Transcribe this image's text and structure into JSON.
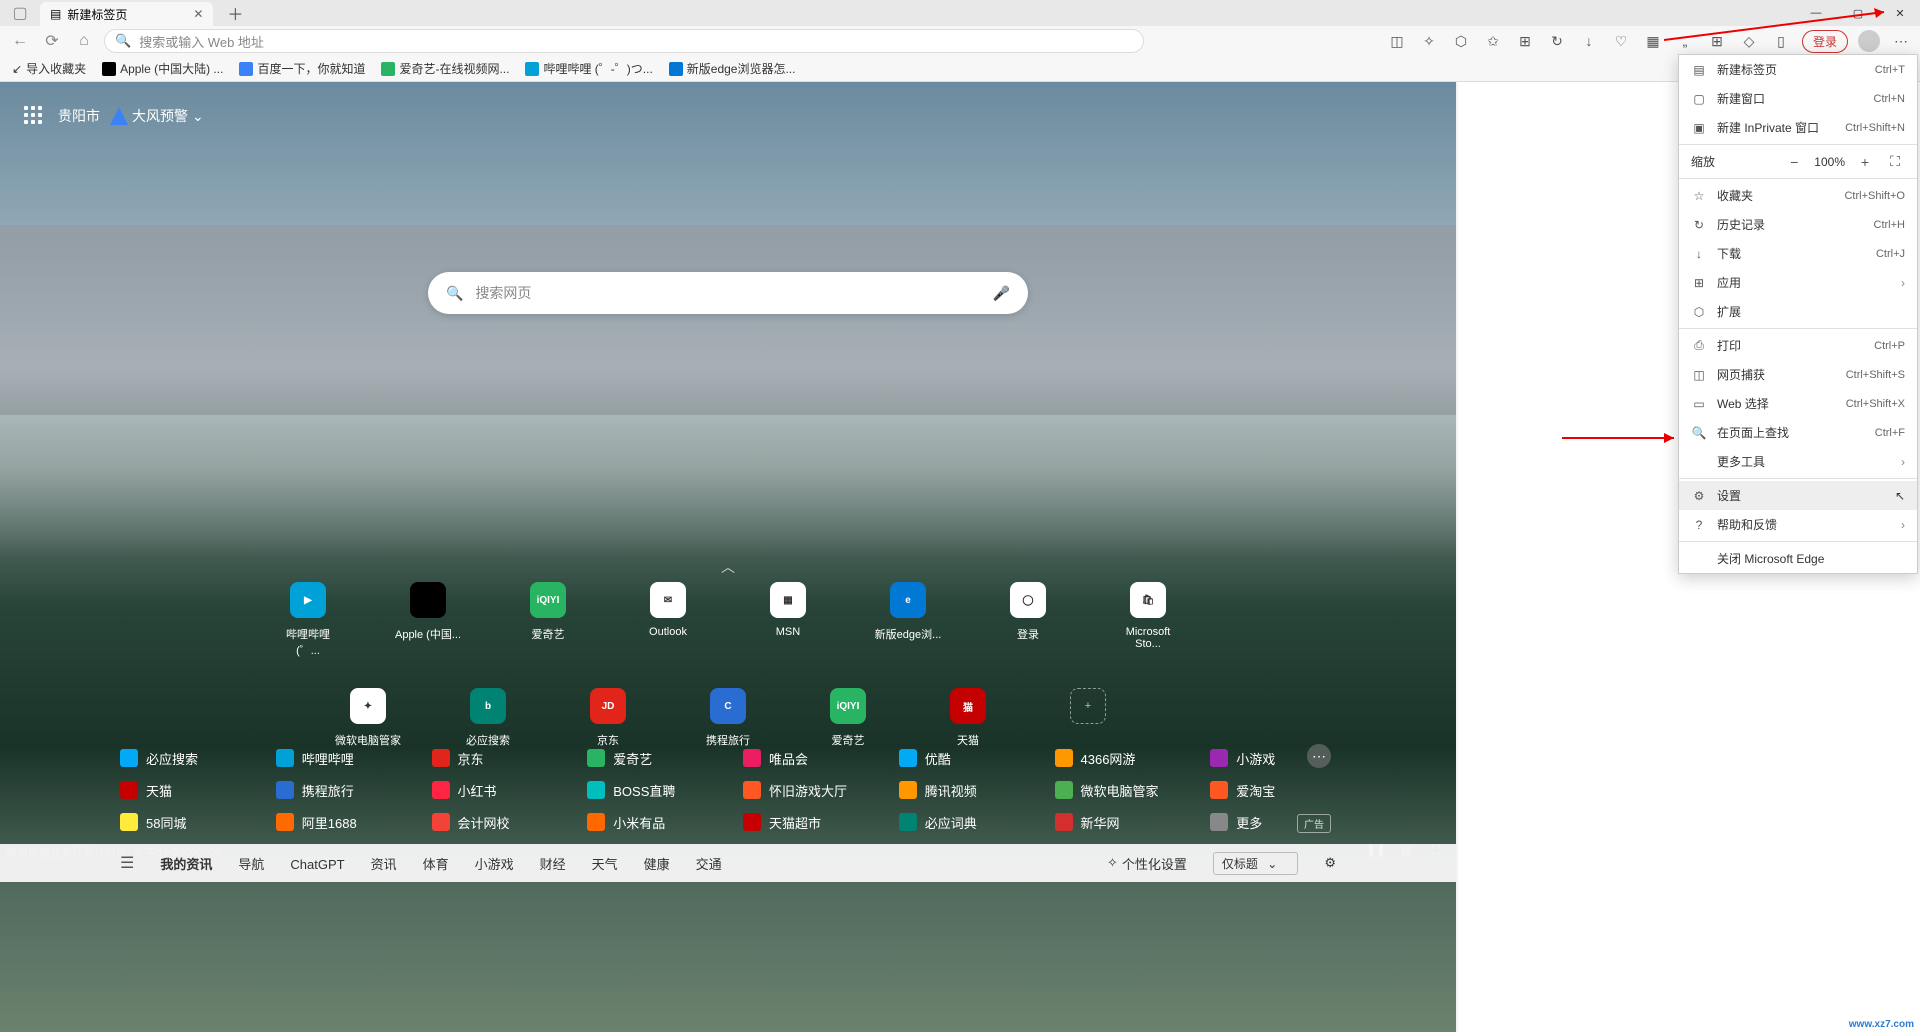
{
  "tab": {
    "title": "新建标签页"
  },
  "address": {
    "placeholder": "搜索或输入 Web 地址"
  },
  "toolbar": {
    "login": "登录"
  },
  "bookmarks": [
    {
      "label": "导入收藏夹",
      "color": "#666"
    },
    {
      "label": "Apple (中国大陆) ...",
      "color": "#000"
    },
    {
      "label": "百度一下，你就知道",
      "color": "#3b82f6"
    },
    {
      "label": "爱奇艺-在线视频网...",
      "color": "#28b463"
    },
    {
      "label": "哔哩哔哩 (゜-゜)つ...",
      "color": "#00a1d6"
    },
    {
      "label": "新版edge浏览器怎...",
      "color": "#0078d4"
    }
  ],
  "location": "贵阳市",
  "weather": "大风预警",
  "search": {
    "placeholder": "搜索网页"
  },
  "quick_links_row1": [
    {
      "label": "哔哩哔哩 (゜...",
      "bg": "#00a1d6",
      "txt": "▶"
    },
    {
      "label": "Apple (中国...",
      "bg": "#000",
      "txt": ""
    },
    {
      "label": "爱奇艺",
      "bg": "#28b463",
      "txt": "iQIYI"
    },
    {
      "label": "Outlook",
      "bg": "#fff",
      "txt": "✉"
    },
    {
      "label": "MSN",
      "bg": "#fff",
      "txt": "▦"
    },
    {
      "label": "新版edge浏...",
      "bg": "#0078d4",
      "txt": "e"
    },
    {
      "label": "登录",
      "bg": "#fff",
      "txt": "◯"
    },
    {
      "label": "Microsoft Sto...",
      "bg": "#fff",
      "txt": "🛍"
    }
  ],
  "quick_links_row2": [
    {
      "label": "微软电脑管家",
      "bg": "#fff",
      "txt": "✦"
    },
    {
      "label": "必应搜索",
      "bg": "#008373",
      "txt": "b"
    },
    {
      "label": "京东",
      "bg": "#e1251b",
      "txt": "JD"
    },
    {
      "label": "携程旅行",
      "bg": "#2a6dd2",
      "txt": "C"
    },
    {
      "label": "爱奇艺",
      "bg": "#28b463",
      "txt": "iQIYI"
    },
    {
      "label": "天猫",
      "bg": "#c40000",
      "txt": "猫"
    }
  ],
  "link_grid": [
    [
      {
        "label": "必应搜索",
        "bg": "#03a9f4"
      },
      {
        "label": "哔哩哔哩",
        "bg": "#00a1d6"
      },
      {
        "label": "京东",
        "bg": "#e1251b"
      },
      {
        "label": "爱奇艺",
        "bg": "#28b463"
      },
      {
        "label": "唯品会",
        "bg": "#e91e63"
      },
      {
        "label": "优酷",
        "bg": "#03a9f4"
      },
      {
        "label": "4366网游",
        "bg": "#ff9800"
      },
      {
        "label": "小游戏",
        "bg": "#9c27b0"
      }
    ],
    [
      {
        "label": "天猫",
        "bg": "#c40000"
      },
      {
        "label": "携程旅行",
        "bg": "#2a6dd2"
      },
      {
        "label": "小红书",
        "bg": "#ff2442"
      },
      {
        "label": "BOSS直聘",
        "bg": "#00bebd"
      },
      {
        "label": "怀旧游戏大厅",
        "bg": "#ff5722"
      },
      {
        "label": "腾讯视频",
        "bg": "#ff9800"
      },
      {
        "label": "微软电脑管家",
        "bg": "#4caf50"
      },
      {
        "label": "爱淘宝",
        "bg": "#ff5722"
      }
    ],
    [
      {
        "label": "58同城",
        "bg": "#ffeb3b"
      },
      {
        "label": "阿里1688",
        "bg": "#ff6a00"
      },
      {
        "label": "会计网校",
        "bg": "#f44336"
      },
      {
        "label": "小米有品",
        "bg": "#ff6700"
      },
      {
        "label": "天猫超市",
        "bg": "#c40000"
      },
      {
        "label": "必应词典",
        "bg": "#008373"
      },
      {
        "label": "新华网",
        "bg": "#d32f2f"
      },
      {
        "label": "更多",
        "bg": "#888"
      }
    ]
  ],
  "ad_label": "广告",
  "license": "增值电信业务经营许可证: 合字B2-20090007",
  "bottom_nav": {
    "items": [
      "我的资讯",
      "导航",
      "ChatGPT",
      "资讯",
      "体育",
      "小游戏",
      "财经",
      "天气",
      "健康",
      "交通"
    ],
    "personalize": "个性化设置",
    "display_mode": "仅标题"
  },
  "ctx_menu": {
    "new_tab": {
      "label": "新建标签页",
      "short": "Ctrl+T"
    },
    "new_window": {
      "label": "新建窗口",
      "short": "Ctrl+N"
    },
    "new_inprivate": {
      "label": "新建 InPrivate 窗口",
      "short": "Ctrl+Shift+N"
    },
    "zoom": {
      "label": "缩放",
      "value": "100%"
    },
    "favorites": {
      "label": "收藏夹",
      "short": "Ctrl+Shift+O"
    },
    "history": {
      "label": "历史记录",
      "short": "Ctrl+H"
    },
    "downloads": {
      "label": "下载",
      "short": "Ctrl+J"
    },
    "apps": {
      "label": "应用"
    },
    "extensions": {
      "label": "扩展"
    },
    "print": {
      "label": "打印",
      "short": "Ctrl+P"
    },
    "capture": {
      "label": "网页捕获",
      "short": "Ctrl+Shift+S"
    },
    "webselect": {
      "label": "Web 选择",
      "short": "Ctrl+Shift+X"
    },
    "find": {
      "label": "在页面上查找",
      "short": "Ctrl+F"
    },
    "moretools": {
      "label": "更多工具"
    },
    "settings": {
      "label": "设置"
    },
    "help": {
      "label": "帮助和反馈"
    },
    "close": {
      "label": "关闭 Microsoft Edge"
    }
  },
  "watermark": "www.xz7.com"
}
